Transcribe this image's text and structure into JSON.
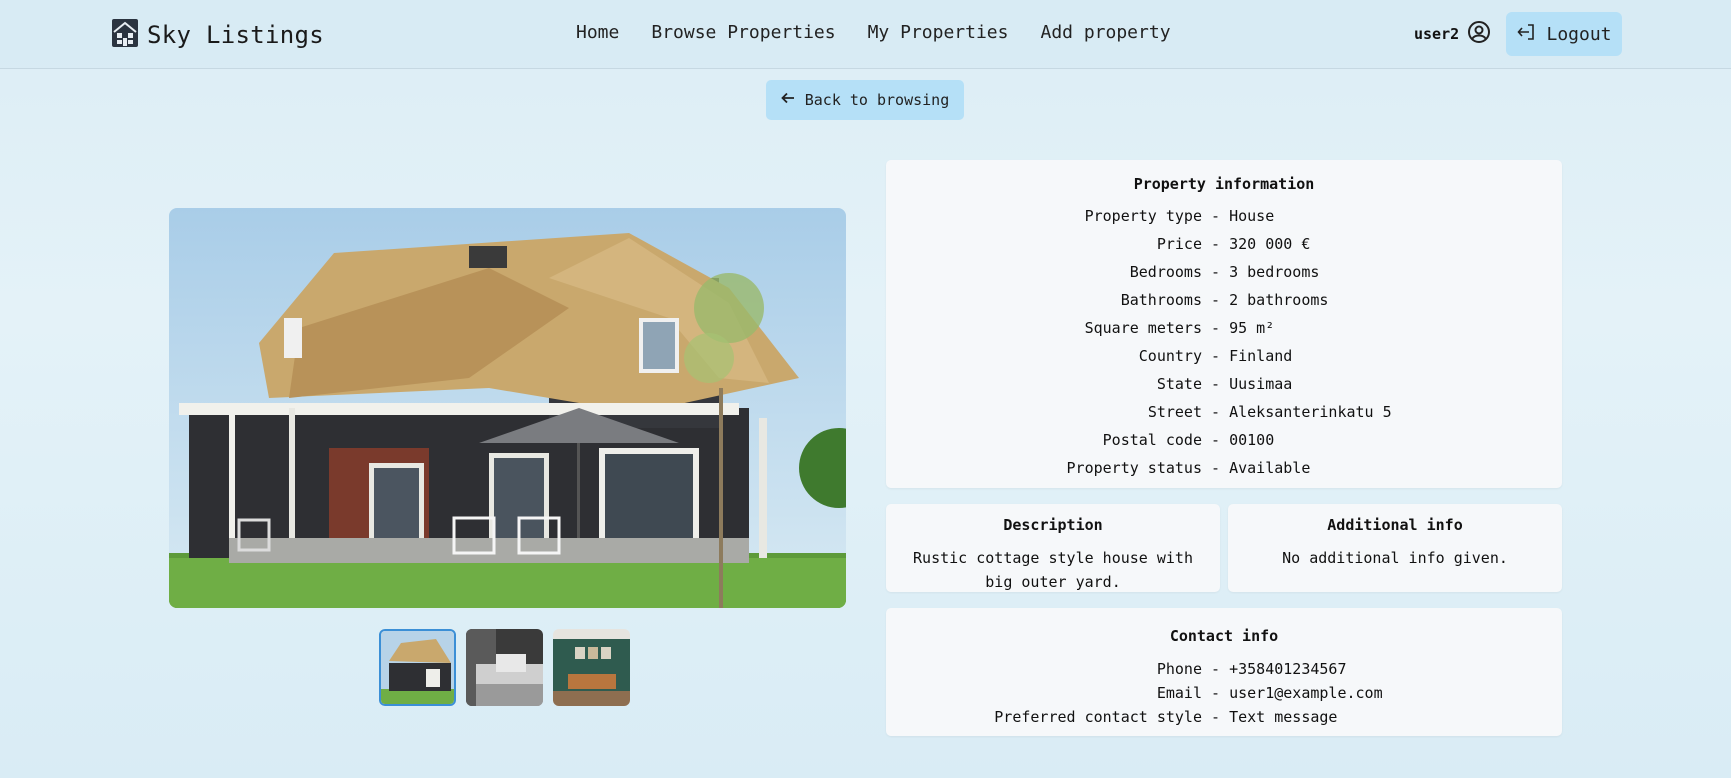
{
  "app": {
    "brand": "Sky Listings"
  },
  "nav": {
    "items": [
      "Home",
      "Browse Properties",
      "My Properties",
      "Add property"
    ]
  },
  "user": {
    "name": "user2",
    "logout_label": "Logout"
  },
  "back_label": "Back to browsing",
  "property_info": {
    "title": "Property information",
    "rows": [
      {
        "label": "Property type",
        "value": "House"
      },
      {
        "label": "Price",
        "value": "320 000 €"
      },
      {
        "label": "Bedrooms",
        "value": "3 bedrooms"
      },
      {
        "label": "Bathrooms",
        "value": "2 bathrooms"
      },
      {
        "label": "Square meters",
        "value": "95 m²"
      },
      {
        "label": "Country",
        "value": "Finland"
      },
      {
        "label": "State",
        "value": "Uusimaa"
      },
      {
        "label": "Street",
        "value": "Aleksanterinkatu 5"
      },
      {
        "label": "Postal code",
        "value": "00100"
      },
      {
        "label": "Property status",
        "value": "Available"
      }
    ]
  },
  "description": {
    "title": "Description",
    "text": "Rustic cottage style house with big outer yard."
  },
  "additional": {
    "title": "Additional info",
    "text": "No additional info given."
  },
  "contact": {
    "title": "Contact info",
    "rows": [
      {
        "label": "Phone",
        "value": "+358401234567"
      },
      {
        "label": "Email",
        "value": "user1@example.com"
      },
      {
        "label": "Preferred contact style",
        "value": "Text message"
      }
    ]
  },
  "colors": {
    "accent": "#b5e0f7",
    "active_thumb_border": "#3b8fd6",
    "card_bg": "#f6f8fa"
  },
  "icons": {
    "logo": "house-logo-icon",
    "user": "user-circle-icon",
    "logout": "logout-icon",
    "back": "arrow-left-icon"
  }
}
